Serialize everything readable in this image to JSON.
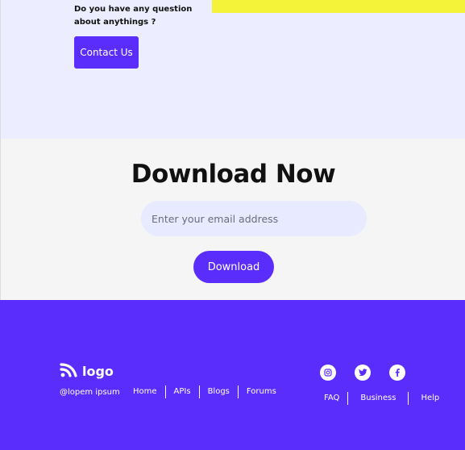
{
  "contact": {
    "question": "Do you have any question about anythings ?",
    "button_label": "Contact Us"
  },
  "download": {
    "title_bold": "Download",
    "title_rest": " Now",
    "email_placeholder": "Enter your email address",
    "button_label": "Download"
  },
  "footer": {
    "logo_text": "logo",
    "tagline": "@lopem ipsum",
    "nav_left": [
      "Home",
      "APIs",
      "Blogs",
      "Forums"
    ],
    "nav_right": [
      "FAQ",
      "Business",
      "Help"
    ],
    "socials": [
      "instagram-icon",
      "twitter-icon",
      "facebook-icon"
    ]
  },
  "colors": {
    "primary": "#5a2dfc",
    "accent_yellow": "#f5f23a",
    "contact_bg": "#eceeff",
    "download_bg": "#f5f5f5",
    "input_bg": "#e8eaff"
  }
}
